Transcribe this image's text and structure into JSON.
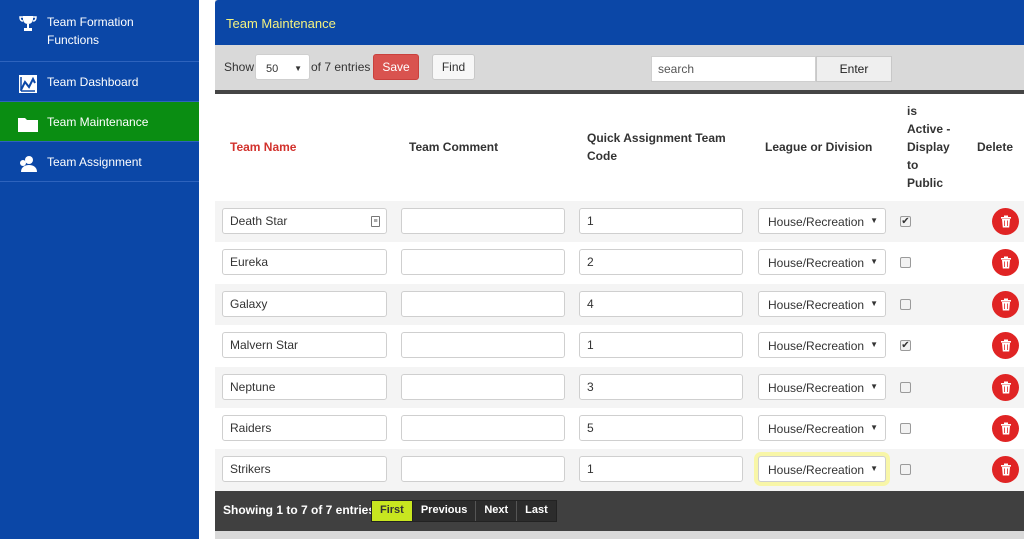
{
  "sidebar": {
    "items": [
      {
        "label": "Team Formation Functions",
        "icon": "trophy-icon"
      },
      {
        "label": "Team Dashboard",
        "icon": "chart-icon"
      },
      {
        "label": "Team Maintenance",
        "icon": "folder-icon"
      },
      {
        "label": "Team Assignment",
        "icon": "user-icon"
      }
    ]
  },
  "panel": {
    "title": "Team Maintenance"
  },
  "toolbar": {
    "show_label": "Show",
    "entries_value": "50",
    "entries_suffix": "of 7 entries",
    "save_label": "Save",
    "find_label": "Find",
    "search_placeholder": "search",
    "enter_label": "Enter"
  },
  "table": {
    "headers": {
      "name": "Team Name",
      "comment": "Team Comment",
      "code_line1": "Quick Assignment Team",
      "code_line2": "Code",
      "league": "League or Division",
      "active_l1": "is",
      "active_l2": "Active -",
      "active_l3": "Display",
      "active_l4": "to",
      "active_l5": "Public",
      "delete": "Delete"
    },
    "rows": [
      {
        "name": "Death Star",
        "comment": "",
        "code": "1",
        "league": "House/Recreation",
        "active": true
      },
      {
        "name": "Eureka",
        "comment": "",
        "code": "2",
        "league": "House/Recreation",
        "active": false
      },
      {
        "name": "Galaxy",
        "comment": "",
        "code": "4",
        "league": "House/Recreation",
        "active": false
      },
      {
        "name": "Malvern Star",
        "comment": "",
        "code": "1",
        "league": "House/Recreation",
        "active": true
      },
      {
        "name": "Neptune",
        "comment": "",
        "code": "3",
        "league": "House/Recreation",
        "active": false
      },
      {
        "name": "Raiders",
        "comment": "",
        "code": "5",
        "league": "House/Recreation",
        "active": false
      },
      {
        "name": "Strikers",
        "comment": "",
        "code": "1",
        "league": "House/Recreation",
        "active": false
      }
    ]
  },
  "footer": {
    "info": "Showing 1 to 7 of 7 entries",
    "pager": [
      "First",
      "Previous",
      "Next",
      "Last"
    ]
  },
  "colors": {
    "sidebar": "#0b47a7",
    "active_nav": "#0a8d12",
    "save": "#d9534f",
    "delete": "#e02424",
    "pager_active": "#c8e620"
  }
}
